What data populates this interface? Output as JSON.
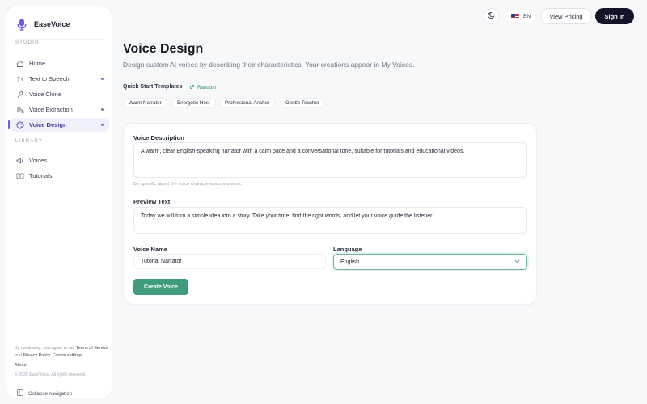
{
  "brand": {
    "name": "EaseVoice",
    "accent": "#6f5ce6"
  },
  "sidebar": {
    "studio_label": "STUDIO",
    "library_label": "LIBRARY",
    "studio_items": [
      {
        "label": "Home",
        "icon": "home-icon",
        "dot": false
      },
      {
        "label": "Text to Speech",
        "icon": "text-speech-icon",
        "dot": true
      },
      {
        "label": "Voice Clone",
        "icon": "voice-clone-icon",
        "dot": false
      },
      {
        "label": "Voice Extraction",
        "icon": "voice-extraction-icon",
        "dot": true
      },
      {
        "label": "Voice Design",
        "icon": "palette-icon",
        "dot": true,
        "active": true
      }
    ],
    "library_items": [
      {
        "label": "Voices",
        "icon": "voices-icon"
      },
      {
        "label": "Tutorials",
        "icon": "book-icon"
      }
    ],
    "legal": {
      "prefix": "By continuing, you agree to our",
      "terms": "Terms of Service",
      "and": "and",
      "privacy": "Privacy Policy",
      "cookie": "Cookie settings"
    },
    "about": "About",
    "copyright": "© 2025 EaseVoice. All rights reserved.",
    "collapse": "Collapse navigation"
  },
  "topbar": {
    "lang": "EN",
    "pricing": "View Pricing",
    "signin": "Sign In"
  },
  "main": {
    "title": "Voice Design",
    "subtitle": "Design custom AI voices by describing their characteristics. Your creations appear in My Voices.",
    "quick_start_label": "Quick Start Templates",
    "random_label": "Random",
    "templates": [
      "Warm Narrator",
      "Energetic Host",
      "Professional Anchor",
      "Gentle Teacher"
    ]
  },
  "form": {
    "description_label": "Voice Description",
    "description_value": "A warm, clear English-speaking narrator with a calm pace and a conversational tone, suitable for tutorials and educational videos.",
    "description_hint": "Be specific about the voice characteristics you want.",
    "preview_label": "Preview Text",
    "preview_value": "Today we will turn a simple idea into a story. Take your time, find the right words, and let your voice guide the listener.",
    "name_label": "Voice Name",
    "name_value": "Tutorial Narrator",
    "language_label": "Language",
    "language_value": "English",
    "create_label": "Create Voice",
    "primary_color": "#3f9c7f"
  }
}
